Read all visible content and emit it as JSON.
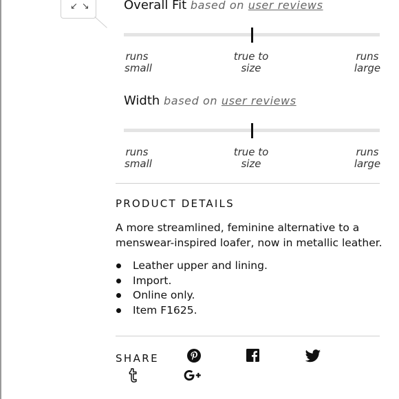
{
  "zoom": {
    "icon": "expand-arrows-icon",
    "glyph": "↙↘"
  },
  "fit": {
    "overall": {
      "title": "Overall Fit",
      "based_on": "based on",
      "link": "user reviews",
      "value_fraction": 0.5,
      "labels": {
        "left": [
          "runs",
          "small"
        ],
        "center": [
          "true to",
          "size"
        ],
        "right": [
          "runs",
          "large"
        ]
      }
    },
    "width": {
      "title": "Width",
      "based_on": "based on",
      "link": "user reviews",
      "value_fraction": 0.5,
      "labels": {
        "left": [
          "runs",
          "small"
        ],
        "center": [
          "true to",
          "size"
        ],
        "right": [
          "runs",
          "large"
        ]
      }
    }
  },
  "details": {
    "title": "PRODUCT DETAILS",
    "description": "A more streamlined, feminine alternative to a menswear-inspired loafer, now in metallic leather.",
    "bullets": [
      "Leather upper and lining.",
      "Import.",
      "Online only.",
      "Item F1625."
    ]
  },
  "share": {
    "label": "SHARE",
    "icons": [
      "pinterest-icon",
      "facebook-icon",
      "twitter-icon",
      "tumblr-icon",
      "google-plus-icon"
    ]
  }
}
